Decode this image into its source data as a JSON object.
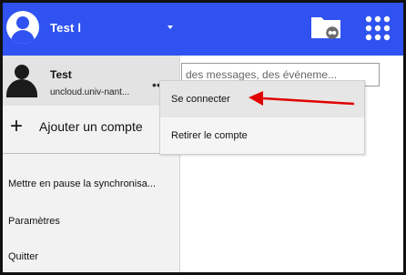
{
  "header": {
    "account_name": "Test l",
    "accent_color": "#2f52f0"
  },
  "left_menu": {
    "account": {
      "name": "Test",
      "server": "uncloud.univ-nant..."
    },
    "add_account_label": "Ajouter un compte",
    "items": [
      {
        "label": "Mettre en pause la synchronisa..."
      },
      {
        "label": "Paramètres"
      },
      {
        "label": "Quitter"
      }
    ]
  },
  "search": {
    "placeholder": "des messages, des événeme..."
  },
  "context_menu": {
    "items": [
      {
        "label": "Se connecter"
      },
      {
        "label": "Retirer le compte"
      }
    ]
  },
  "annotation": {
    "arrow_color": "#e00000"
  }
}
